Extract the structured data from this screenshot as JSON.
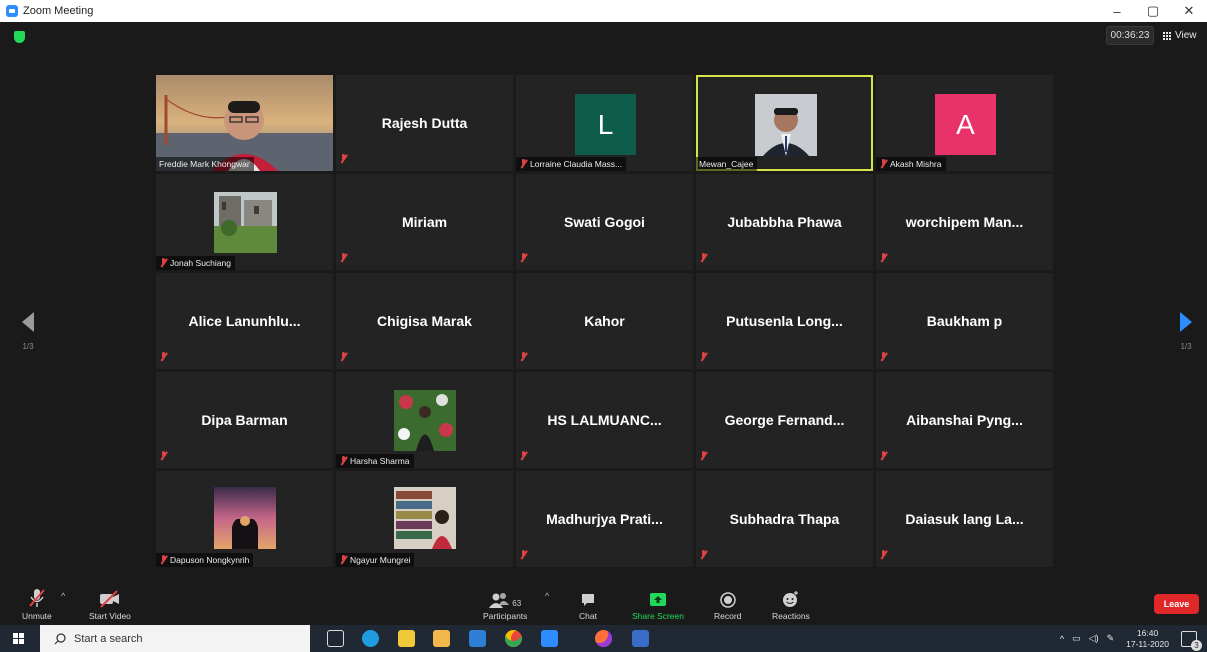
{
  "window": {
    "title": "Zoom Meeting",
    "controls": [
      "–",
      "▢",
      "✕"
    ]
  },
  "meeting": {
    "timer": "00:36:23",
    "view_label": "View",
    "page_indicator_left": "1/3",
    "page_indicator_right": "1/3"
  },
  "participants": [
    {
      "name": "Freddie Mark Khongwar",
      "display": "video",
      "muted": false
    },
    {
      "name": "Rajesh Dutta",
      "display": "name",
      "muted": true
    },
    {
      "name": "Lorraine Claudia Mass...",
      "display": "avatar",
      "initial": "L",
      "avatar_color": "#0e5c4a",
      "muted": true
    },
    {
      "name": "Mewan_Cajee",
      "display": "photo",
      "muted": false,
      "active_speaker": true
    },
    {
      "name": "Akash Mishra",
      "display": "avatar",
      "initial": "A",
      "avatar_color": "#e8326a",
      "muted": true
    },
    {
      "name": "Jonah Suchiang",
      "display": "photo",
      "muted": true
    },
    {
      "name": "Miriam",
      "display": "name",
      "muted": true
    },
    {
      "name": "Swati Gogoi",
      "display": "name",
      "muted": true
    },
    {
      "name": "Jubabbha Phawa",
      "display": "name",
      "muted": true
    },
    {
      "name": "worchipem Man...",
      "display": "name",
      "muted": true
    },
    {
      "name": "Alice Lanunhlu...",
      "display": "name",
      "muted": true
    },
    {
      "name": "Chigisa Marak",
      "display": "name",
      "muted": true
    },
    {
      "name": "Kahor",
      "display": "name",
      "muted": true
    },
    {
      "name": "Putusenla Long...",
      "display": "name",
      "muted": true
    },
    {
      "name": "Baukham p",
      "display": "name",
      "muted": true
    },
    {
      "name": "Dipa Barman",
      "display": "name",
      "muted": true
    },
    {
      "name": "Harsha Sharma",
      "display": "photo",
      "muted": true
    },
    {
      "name": "HS LALMUANC...",
      "display": "name",
      "muted": true
    },
    {
      "name": "George Fernand...",
      "display": "name",
      "muted": true
    },
    {
      "name": "Aibanshai Pyng...",
      "display": "name",
      "muted": true
    },
    {
      "name": "Dapuson Nongkynrih",
      "display": "photo",
      "muted": true
    },
    {
      "name": "Ngayur Mungrei",
      "display": "photo",
      "muted": true
    },
    {
      "name": "Madhurjya Prati...",
      "display": "name",
      "muted": true
    },
    {
      "name": "Subhadra Thapa",
      "display": "name",
      "muted": true
    },
    {
      "name": "Daiasuk lang La...",
      "display": "name",
      "muted": true
    }
  ],
  "toolbar": {
    "unmute": "Unmute",
    "start_video": "Start Video",
    "participants": "Participants",
    "participants_count": "63",
    "chat": "Chat",
    "share_screen": "Share Screen",
    "record": "Record",
    "reactions": "Reactions",
    "leave": "Leave"
  },
  "taskbar": {
    "search_placeholder": "Start a search",
    "time": "16:40",
    "date": "17-11-2020",
    "notification_count": "3"
  },
  "colors": {
    "active_speaker_border": "#d8e34a",
    "share_green": "#23d959",
    "leave_red": "#e02828",
    "nav_blue": "#2d8cff"
  }
}
